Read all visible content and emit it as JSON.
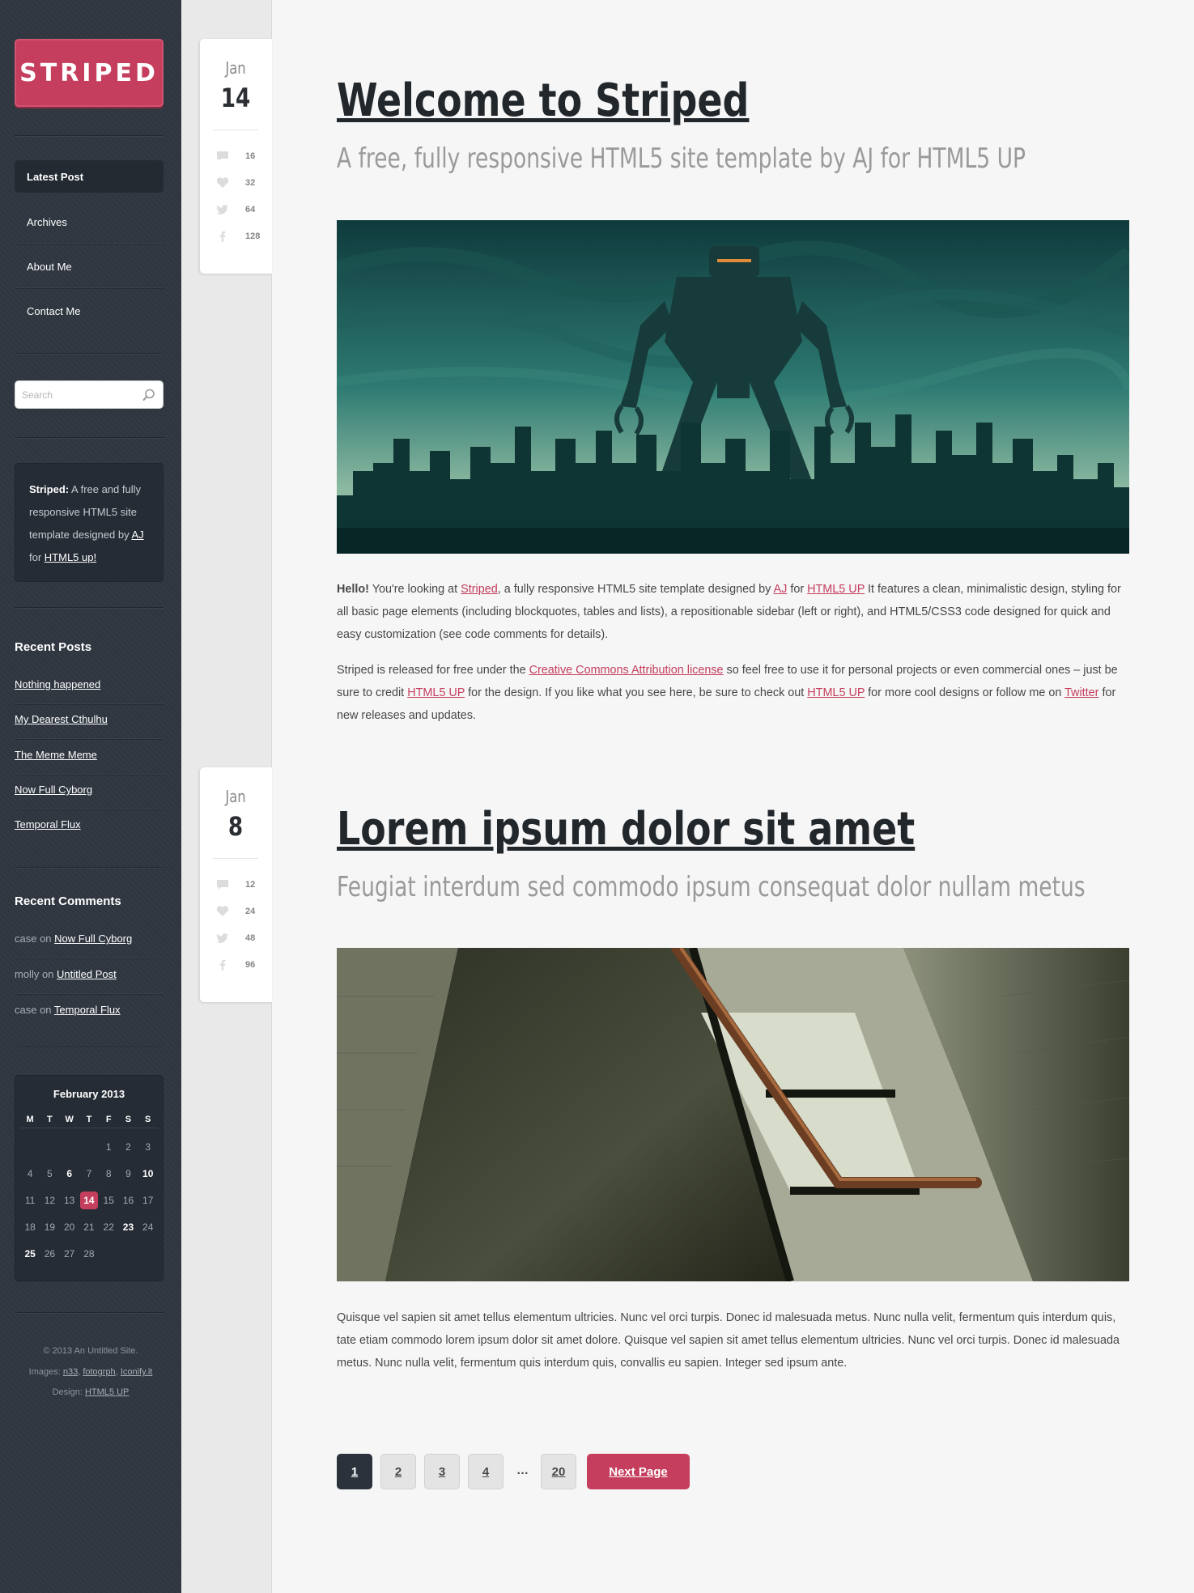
{
  "site": {
    "logo": "STRIPED"
  },
  "nav": [
    {
      "label": "Latest Post",
      "active": true
    },
    {
      "label": "Archives",
      "active": false
    },
    {
      "label": "About Me",
      "active": false
    },
    {
      "label": "Contact Me",
      "active": false
    }
  ],
  "search": {
    "placeholder": "Search"
  },
  "about_box": {
    "strong": "Striped:",
    "text_before": " A free and fully responsive HTML5 site template designed by ",
    "link1": "AJ",
    "text_mid": " for ",
    "link2": "HTML5 up!"
  },
  "recent_posts": {
    "heading": "Recent Posts",
    "items": [
      "Nothing happened",
      "My Dearest Cthulhu",
      "The Meme Meme",
      "Now Full Cyborg",
      "Temporal Flux"
    ]
  },
  "recent_comments": {
    "heading": "Recent Comments",
    "items": [
      {
        "author": "case",
        "on": " on ",
        "post": "Now Full Cyborg"
      },
      {
        "author": "molly",
        "on": " on ",
        "post": "Untitled Post"
      },
      {
        "author": "case",
        "on": " on ",
        "post": "Temporal Flux"
      }
    ]
  },
  "calendar": {
    "title": "February 2013",
    "weekdays": [
      "M",
      "T",
      "W",
      "T",
      "F",
      "S",
      "S"
    ],
    "weeks": [
      [
        "",
        "",
        "",
        "",
        "1",
        "2",
        "3"
      ],
      [
        "4",
        "5",
        "6",
        "7",
        "8",
        "9",
        "10"
      ],
      [
        "11",
        "12",
        "13",
        "14",
        "15",
        "16",
        "17"
      ],
      [
        "18",
        "19",
        "20",
        "21",
        "22",
        "23",
        "24"
      ],
      [
        "25",
        "26",
        "27",
        "28",
        "",
        "",
        ""
      ]
    ],
    "bold_days": [
      "6",
      "10",
      "23",
      "25"
    ],
    "today": "14"
  },
  "footer": {
    "copyright": "© 2013 An Untitled Site.",
    "images_label": "Images: ",
    "images_links": [
      "n33",
      "fotogrph",
      "Iconify.it"
    ],
    "design_label": "Design: ",
    "design_link": "HTML5 UP"
  },
  "posts": [
    {
      "month": "Jan",
      "day": "14",
      "stats": {
        "comments": "16",
        "likes": "32",
        "twitter": "64",
        "facebook": "128"
      },
      "title": "Welcome to Striped",
      "subtitle": "A free, fully responsive HTML5 site template by AJ for HTML5 UP",
      "body": {
        "p1": {
          "hello": "Hello!",
          "t1": " You're looking at ",
          "l1": "Striped",
          "t2": ", a fully responsive HTML5 site template designed by ",
          "l2": "AJ",
          "t3": " for ",
          "l3": "HTML5 UP",
          "t4": " It features a clean, minimalistic design, styling for all basic page elements (including blockquotes, tables and lists), a repositionable sidebar (left or right), and HTML5/CSS3 code designed for quick and easy customization (see code comments for details)."
        },
        "p2": {
          "t1": "Striped is released for free under the ",
          "l1": "Creative Commons Attribution license",
          "t2": " so feel free to use it for personal projects or even commercial ones – just be sure to credit ",
          "l2": "HTML5 UP",
          "t3": " for the design. If you like what you see here, be sure to check out ",
          "l3": "HTML5 UP",
          "t4": " for more cool designs or follow me on ",
          "l4": "Twitter",
          "t5": " for new releases and updates."
        }
      }
    },
    {
      "month": "Jan",
      "day": "8",
      "stats": {
        "comments": "12",
        "likes": "24",
        "twitter": "48",
        "facebook": "96"
      },
      "title": "Lorem ipsum dolor sit amet",
      "subtitle": "Feugiat interdum sed commodo ipsum consequat dolor nullam metus",
      "body": "Quisque vel sapien sit amet tellus elementum ultricies. Nunc vel orci turpis. Donec id malesuada metus. Nunc nulla velit, fermentum quis interdum quis, tate etiam commodo lorem ipsum dolor sit amet dolore. Quisque vel sapien sit amet tellus elementum ultricies. Nunc vel orci turpis. Donec id malesuada metus. Nunc nulla velit, fermentum quis interdum quis, convallis eu sapien. Integer sed ipsum ante."
    }
  ],
  "pagination": {
    "pages": [
      "1",
      "2",
      "3",
      "4"
    ],
    "ellipsis": "…",
    "last": "20",
    "next": "Next Page",
    "active": "1"
  },
  "colors": {
    "accent": "#c53e5d",
    "sidebar": "#2f3640",
    "title": "#22272c"
  }
}
